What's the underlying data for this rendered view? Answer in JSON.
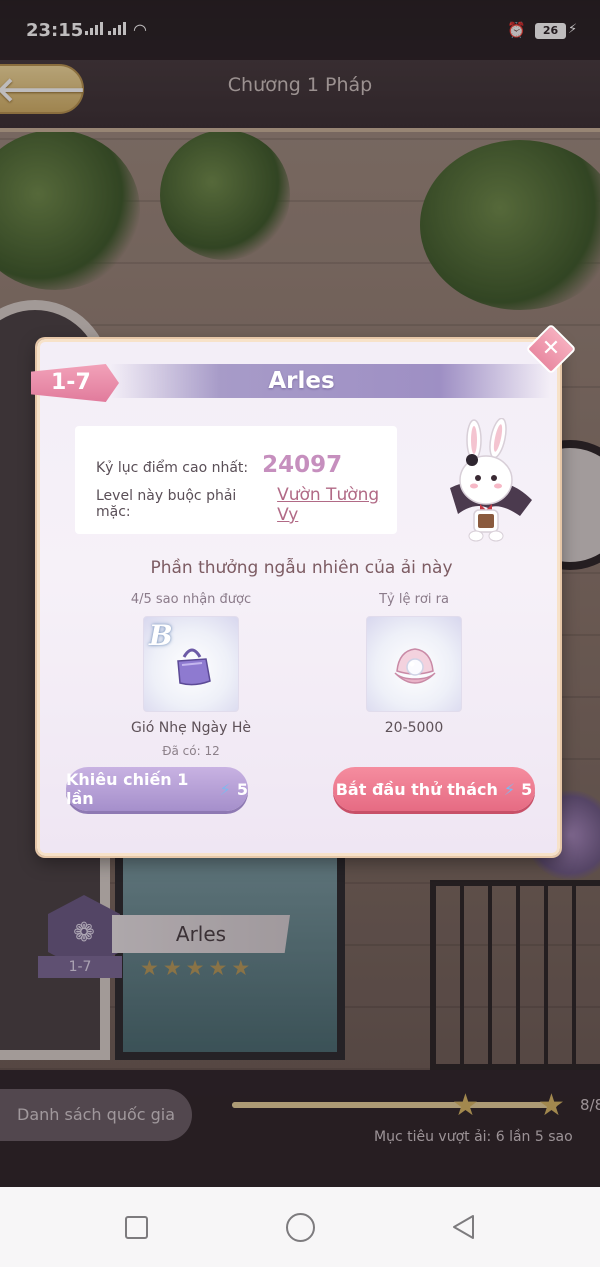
{
  "status_bar": {
    "time": "23:15",
    "battery": "26"
  },
  "header": {
    "title": "Chương 1 Pháp",
    "back_icon": "back-arrow-icon"
  },
  "popup": {
    "level_code": "1-7",
    "level_name": "Arles",
    "best_score_label": "Kỷ lục điểm cao nhất:",
    "best_score_value": "24097",
    "required_outfit_label": "Level này buộc phải mặc:",
    "required_outfit_value": "Vườn Tường Vy",
    "reward_title": "Phần thưởng ngẫu nhiên của ải này",
    "rewards": [
      {
        "header": "4/5 sao nhận được",
        "name": "Gió Nhẹ Ngày Hè",
        "sub": "Đã có: 12",
        "icon": "handbag-icon",
        "grade": "B"
      },
      {
        "header": "Tỷ lệ rơi ra",
        "name": "20-5000",
        "icon": "pearl-shell-icon"
      }
    ],
    "challenge_once_label": "Khiêu chiến 1 lần",
    "challenge_once_cost": "5",
    "start_label": "Bắt đầu thử thách",
    "start_cost": "5"
  },
  "level_card": {
    "code": "1-7",
    "name": "Arles",
    "stars": 5
  },
  "bottom": {
    "country_list_label": "Danh sách quốc gia",
    "progress_count": "8/8",
    "progress_fraction": 1.0,
    "goal_text": "Mục tiêu vượt ải: 6 lần 5 sao"
  },
  "colors": {
    "accent_pink": "#e66b83",
    "accent_purple": "#a58fcb",
    "score_pink": "#c68fbe",
    "gold": "#d8b866"
  }
}
